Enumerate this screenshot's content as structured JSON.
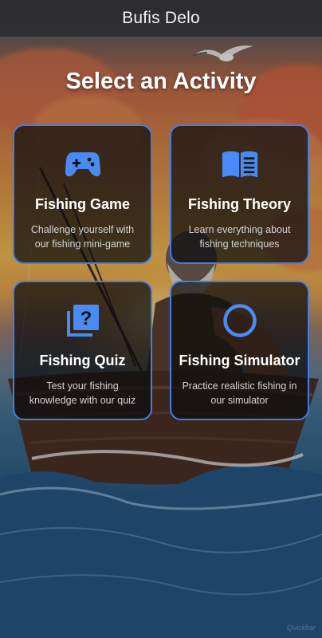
{
  "app_bar": {
    "title": "Bufis Delo"
  },
  "heading": "Select an Activity",
  "colors": {
    "accent": "#3f7fe6",
    "icon": "#4a8af4",
    "card_bg": "rgba(12,12,14,0.72)"
  },
  "cards": [
    {
      "title": "Fishing Game",
      "description": "Challenge yourself with our fishing mini-game",
      "icon": "gamepad-icon"
    },
    {
      "title": "Fishing Theory",
      "description": "Learn everything about fishing techniques",
      "icon": "book-icon"
    },
    {
      "title": "Fishing Quiz",
      "description": "Test your fishing knowledge with our quiz",
      "icon": "quiz-icon"
    },
    {
      "title": "Fishing Simulator",
      "description": "Practice realistic fishing in our simulator",
      "icon": "circle-icon"
    }
  ]
}
